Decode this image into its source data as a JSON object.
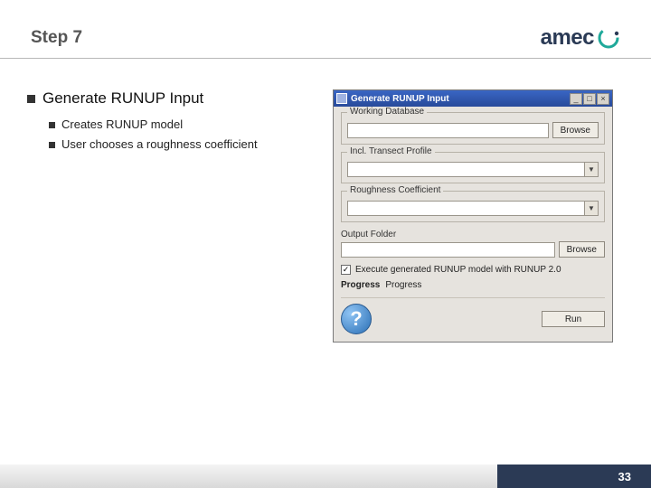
{
  "header": {
    "title": "Step 7",
    "logo_text": "amec"
  },
  "left": {
    "main_bullet": "Generate RUNUP Input",
    "sub": [
      "Creates RUNUP model",
      "User chooses a roughness coefficient"
    ]
  },
  "dialog": {
    "title": "Generate RUNUP Input",
    "group_working_db": "Working Database",
    "browse": "Browse",
    "group_transect": "Incl. Transect Profile",
    "group_roughness": "Roughness Coefficient",
    "output_folder_label": "Output Folder",
    "checkbox_label": "Execute generated RUNUP model with RUNUP 2.0",
    "progress_label": "Progress",
    "progress_sub": "Progress",
    "run": "Run"
  },
  "footer": {
    "page": "33"
  }
}
